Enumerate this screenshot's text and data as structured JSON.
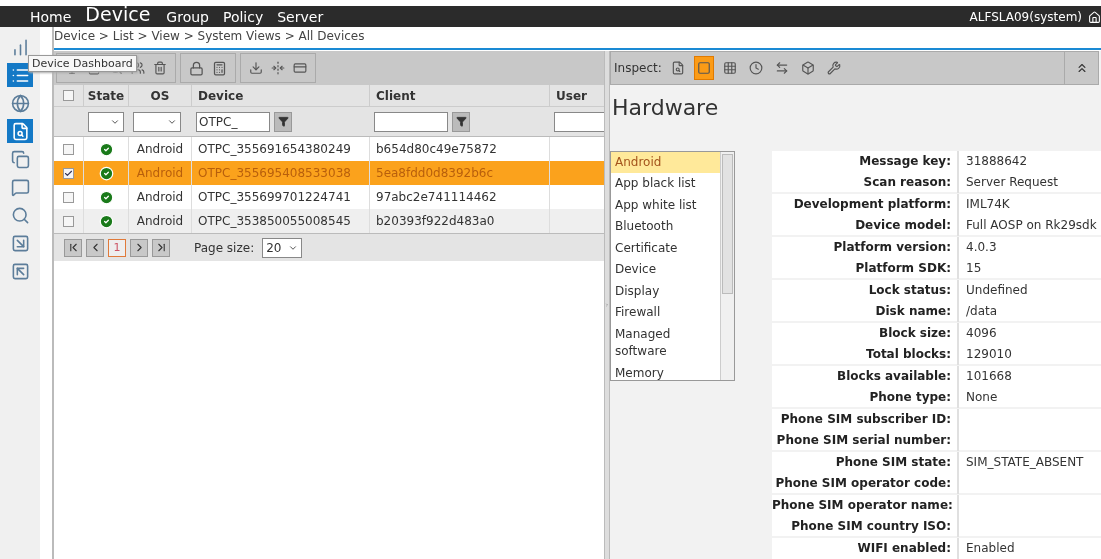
{
  "nav": {
    "items": [
      {
        "label": "Home",
        "selected": false
      },
      {
        "label": "Device",
        "selected": true
      },
      {
        "label": "Group",
        "selected": false
      },
      {
        "label": "Policy",
        "selected": false
      },
      {
        "label": "Server",
        "selected": false
      }
    ],
    "user": "ALFSLA09(system)"
  },
  "sidebar": {
    "items": [
      {
        "selected": false
      },
      {
        "selected": true
      },
      {
        "selected": false
      },
      {
        "selected": true
      },
      {
        "selected": false
      },
      {
        "selected": false
      },
      {
        "selected": false
      },
      {
        "selected": false
      },
      {
        "selected": false
      }
    ]
  },
  "tooltip": "Device Dashboard",
  "breadcrumb": "Device > List > View > System Views > All Devices",
  "table": {
    "all_checked": false,
    "columns": [
      "State",
      "OS",
      "Device",
      "Client",
      "User"
    ],
    "device_filter": "OTPC_",
    "rows": [
      {
        "checked": false,
        "selected": false,
        "os": "Android",
        "device": "OTPC_355691654380249",
        "client": "b654d80c49e75872"
      },
      {
        "checked": true,
        "selected": true,
        "os": "Android",
        "device": "OTPC_355695408533038",
        "client": "5ea8fdd0d8392b6c"
      },
      {
        "checked": false,
        "selected": false,
        "os": "Android",
        "device": "OTPC_355699701224741",
        "client": "97abc2e741114462"
      },
      {
        "checked": false,
        "selected": false,
        "os": "Android",
        "device": "OTPC_353850055008545",
        "client": "b20393f922d483a0"
      }
    ]
  },
  "pager": {
    "page": "1",
    "page_size_label": "Page size:",
    "page_size": "20"
  },
  "inspect": {
    "label": "Inspect:",
    "tools": [
      {
        "selected": false
      },
      {
        "selected": true
      },
      {
        "selected": false
      },
      {
        "selected": false
      },
      {
        "selected": false
      },
      {
        "selected": false
      },
      {
        "selected": false
      }
    ]
  },
  "title": "Hardware",
  "categories": [
    {
      "label": "Android",
      "selected": true
    },
    {
      "label": "App black list",
      "selected": false
    },
    {
      "label": "App white list",
      "selected": false
    },
    {
      "label": "Bluetooth",
      "selected": false
    },
    {
      "label": "Certificate",
      "selected": false
    },
    {
      "label": "Device",
      "selected": false
    },
    {
      "label": "Display",
      "selected": false
    },
    {
      "label": "Firewall",
      "selected": false
    },
    {
      "label": "Managed software",
      "selected": false
    },
    {
      "label": "Memory",
      "selected": false
    }
  ],
  "properties": [
    {
      "label": "Message key:",
      "value": "31888642"
    },
    {
      "label": "Scan reason:",
      "value": "Server Request"
    },
    {
      "label": "Development platform:",
      "value": "IML74K"
    },
    {
      "label": "Device model:",
      "value": "Full AOSP on Rk29sdk"
    },
    {
      "label": "Platform version:",
      "value": "4.0.3"
    },
    {
      "label": "Platform SDK:",
      "value": "15"
    },
    {
      "label": "Lock status:",
      "value": "Undefined"
    },
    {
      "label": "Disk name:",
      "value": "/data"
    },
    {
      "label": "Block size:",
      "value": "4096"
    },
    {
      "label": "Total blocks:",
      "value": "129010"
    },
    {
      "label": "Blocks available:",
      "value": "101668"
    },
    {
      "label": "Phone type:",
      "value": "None"
    },
    {
      "label": "Phone SIM subscriber ID:"
    },
    {
      "label": "Phone SIM serial number:"
    },
    {
      "label": "Phone SIM state:",
      "value": "SIM_STATE_ABSENT"
    },
    {
      "label": "Phone SIM operator code:"
    },
    {
      "label": "Phone SIM operator name:"
    },
    {
      "label": "Phone SIM country ISO:"
    },
    {
      "label": "WIFI enabled:",
      "value": "Enabled"
    }
  ]
}
